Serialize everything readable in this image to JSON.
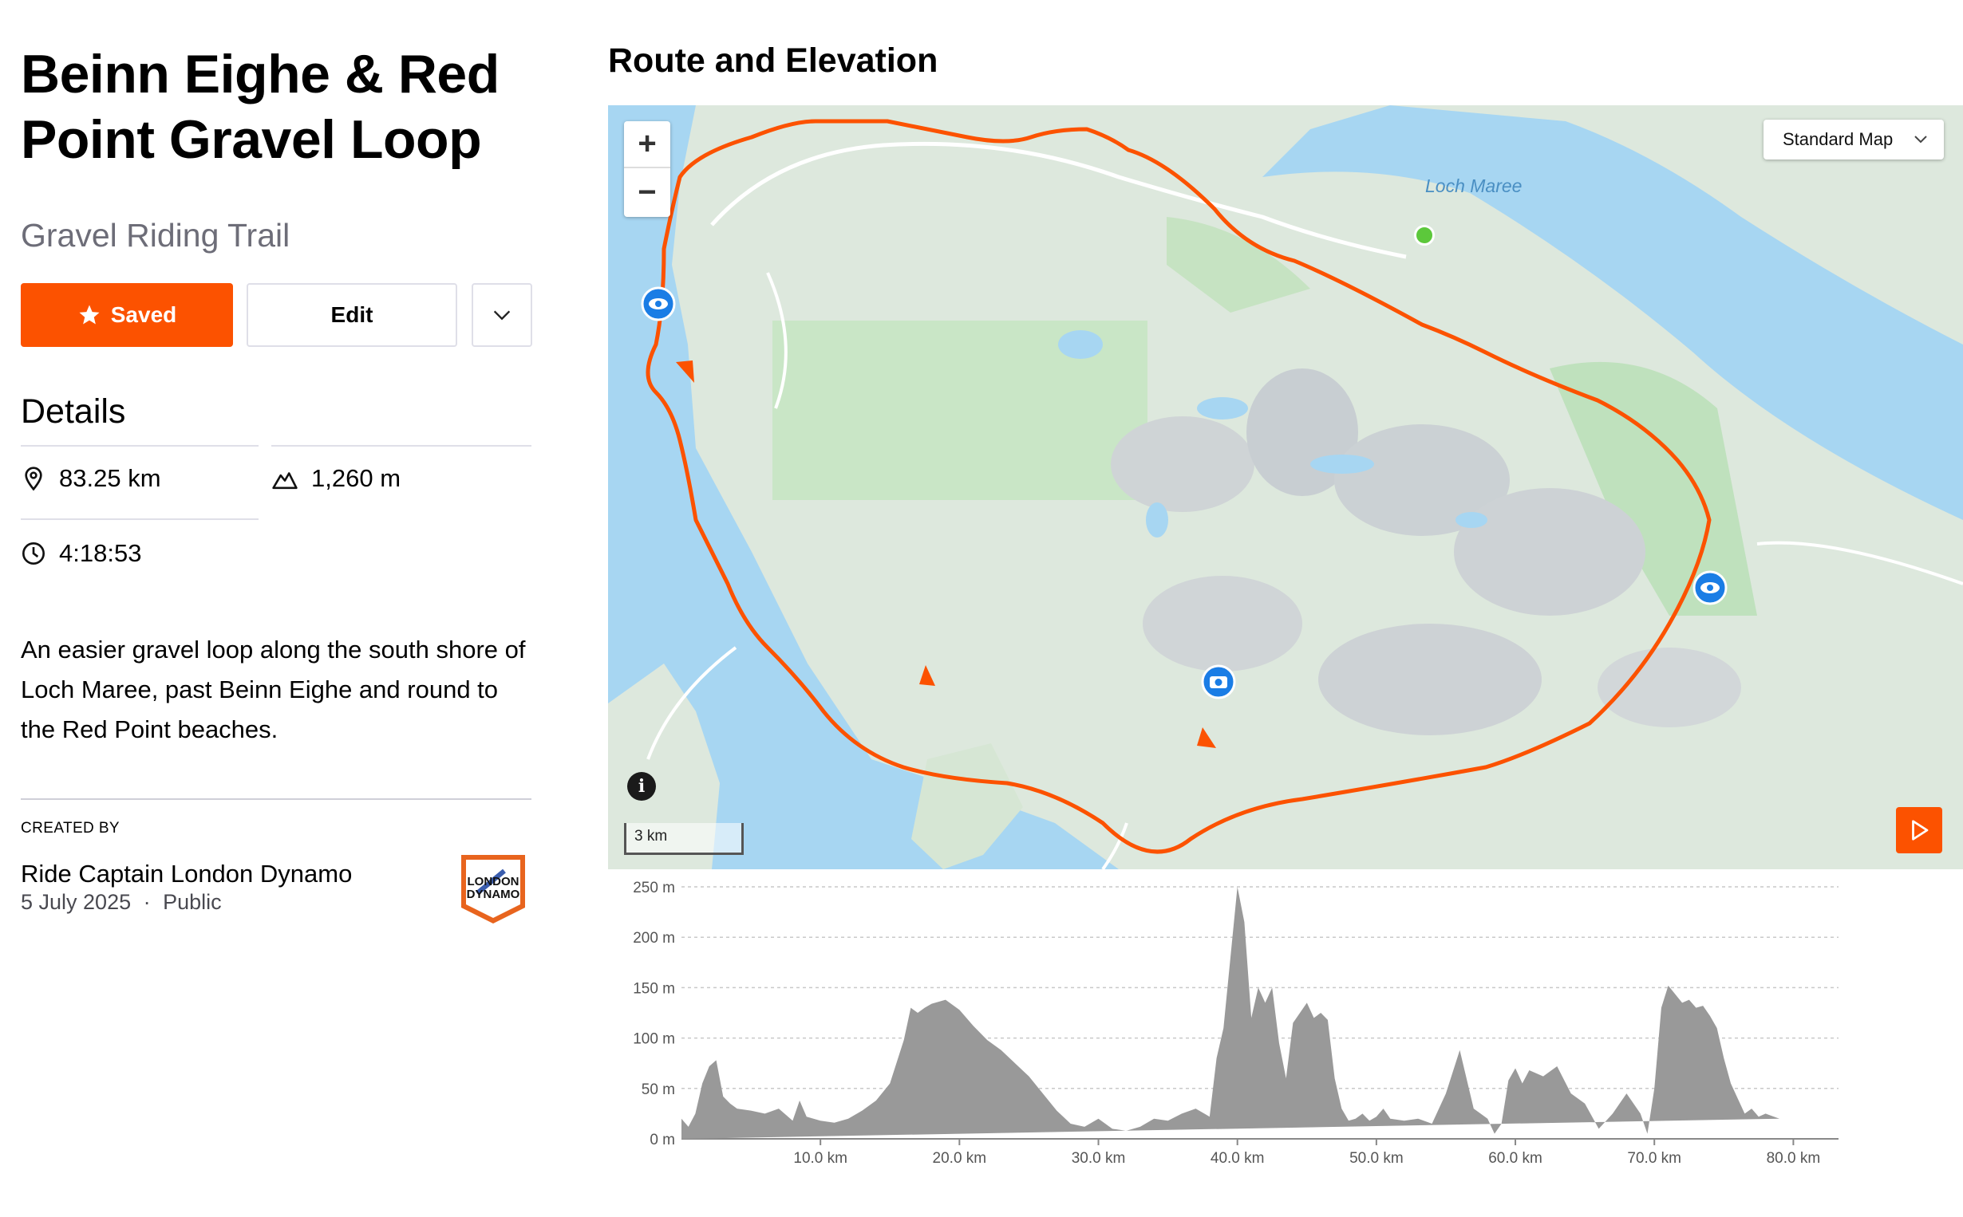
{
  "title": "Beinn Eighe & Red Point Gravel Loop",
  "subtitle": "Gravel Riding Trail",
  "actions": {
    "saved_label": "Saved",
    "edit_label": "Edit",
    "more_icon": "chevron-down-icon"
  },
  "details": {
    "heading": "Details",
    "distance": "83.25 km",
    "elevation_gain": "1,260 m",
    "moving_time": "4:18:53"
  },
  "description": "An easier gravel loop along the south shore of Loch Maree, past Beinn Eighe and round to the Red Point beaches.",
  "creator": {
    "label": "CREATED BY",
    "name": "Ride Captain London Dynamo",
    "date": "5 July 2025",
    "separator": "·",
    "visibility": "Public",
    "logo_text": "LONDON DYNAMO"
  },
  "route": {
    "heading": "Route and Elevation",
    "map_style": "Standard Map",
    "zoom_in": "+",
    "zoom_out": "−",
    "map_label": "Loch Maree",
    "scale": "3 km",
    "info": "i",
    "route_color": "#fc5200",
    "start_color": "#5cc83b",
    "poi_icons": [
      "eye-icon",
      "eye-icon",
      "camera-icon",
      "camera-icon"
    ]
  },
  "chart_data": {
    "type": "area",
    "xlabel": "",
    "ylabel": "",
    "xlim": [
      0,
      83.25
    ],
    "ylim": [
      0,
      250
    ],
    "x_ticks": [
      10,
      20,
      30,
      40,
      50,
      60,
      70,
      80
    ],
    "x_tick_labels": [
      "10.0 km",
      "20.0 km",
      "30.0 km",
      "40.0 km",
      "50.0 km",
      "60.0 km",
      "70.0 km",
      "80.0 km"
    ],
    "y_ticks": [
      0,
      50,
      100,
      150,
      200,
      250
    ],
    "y_tick_labels": [
      "0 m",
      "50 m",
      "100 m",
      "150 m",
      "200 m",
      "250 m"
    ],
    "grid": true,
    "color": "#999999",
    "x": [
      0,
      0.5,
      1,
      1.5,
      2,
      2.5,
      3,
      3.5,
      4,
      5,
      6,
      7,
      8,
      8.5,
      9,
      9.5,
      10,
      11,
      12,
      13,
      14,
      15,
      16,
      16.5,
      17,
      17.5,
      18,
      19,
      20,
      21,
      22,
      23,
      24,
      25,
      26,
      27,
      28,
      29,
      30,
      31,
      32,
      33,
      34,
      35,
      36,
      37,
      38,
      38.5,
      39,
      39.5,
      40,
      40.5,
      41,
      41.5,
      42,
      42.5,
      43,
      43.5,
      44,
      44.5,
      45,
      45.5,
      46,
      46.5,
      47,
      47.5,
      48,
      48.5,
      49,
      49.5,
      50,
      50.5,
      51,
      52,
      53,
      54,
      55,
      56,
      57,
      58,
      58.5,
      59,
      59.5,
      60,
      60.5,
      61,
      62,
      63,
      64,
      65,
      66,
      67,
      68,
      69,
      69.5,
      70,
      70.5,
      71,
      72,
      72.5,
      73,
      73.5,
      74,
      74.5,
      75,
      75.5,
      76,
      76.5,
      77,
      77.5,
      78,
      79,
      80,
      81,
      82,
      83.25
    ],
    "values": [
      20,
      12,
      25,
      55,
      72,
      78,
      42,
      35,
      30,
      28,
      25,
      30,
      18,
      38,
      22,
      20,
      18,
      16,
      20,
      28,
      38,
      55,
      98,
      130,
      125,
      130,
      134,
      138,
      128,
      112,
      98,
      88,
      75,
      62,
      45,
      28,
      15,
      12,
      20,
      10,
      8,
      12,
      20,
      18,
      25,
      30,
      22,
      80,
      110,
      180,
      250,
      215,
      120,
      150,
      135,
      150,
      95,
      60,
      115,
      125,
      135,
      120,
      125,
      118,
      60,
      30,
      18,
      20,
      25,
      18,
      22,
      30,
      20,
      18,
      20,
      15,
      45,
      88,
      30,
      20,
      5,
      15,
      58,
      70,
      55,
      68,
      62,
      72,
      45,
      35,
      10,
      25,
      45,
      25,
      5,
      50,
      130,
      152,
      135,
      138,
      130,
      132,
      122,
      110,
      80,
      55,
      40,
      25,
      30,
      22,
      25,
      20
    ]
  }
}
